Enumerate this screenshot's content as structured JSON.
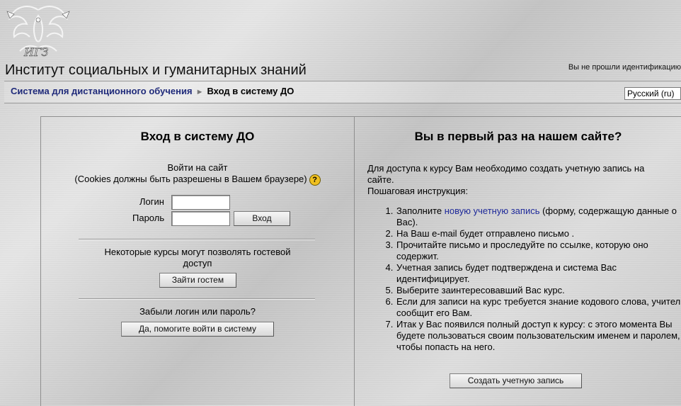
{
  "header": {
    "site_title": "Институт социальных и гуманитарных знаний",
    "login_info": "Вы не прошли идентификацию"
  },
  "navbar": {
    "crumb_home": "Система для дистанционного обучения",
    "separator": "►",
    "crumb_current": "Вход в систему ДО",
    "language": "Русский (ru)"
  },
  "login": {
    "title": "Вход в систему ДО",
    "enter_site": "Войти на сайт",
    "cookies_note": "(Cookies должны быть разрешены в Вашем браузере)",
    "help_icon": "?",
    "username_label": "Логин",
    "password_label": "Пароль",
    "username_value": "",
    "password_value": "",
    "login_button": "Вход",
    "guest_text": "Некоторые курсы могут позволять гостевой доступ",
    "guest_button": "Зайти гостем",
    "forgot_text": "Забыли логин или пароль?",
    "forgot_button": "Да, помогите войти в систему"
  },
  "signup": {
    "title": "Вы в первый раз на нашем сайте?",
    "intro_line1": "Для доступа к курсу Вам необходимо создать учетную запись на сайте.",
    "intro_line2": "Пошаговая инструкция:",
    "step1_prefix": "Заполните ",
    "step1_link": "новую учетную запись",
    "step1_suffix": " (форму, содержащую данные о Вас).",
    "steps": [
      "На Ваш e-mail будет отправлено письмо .",
      "Прочитайте письмо и проследуйте по ссылке, которую оно содержит.",
      "Учетная запись будет подтверждена и система Вас идентифицирует.",
      "Выберите заинтересовавший Вас курс.",
      "Если для записи на курс требуется знание кодового слова, учитель сообщит его Вам.",
      "Итак у Вас появился полный доступ к курсу: с этого момента Вы будете пользоваться своим пользовательским именем и паролем, чтобы попасть на него."
    ],
    "create_button": "Создать учетную запись"
  }
}
